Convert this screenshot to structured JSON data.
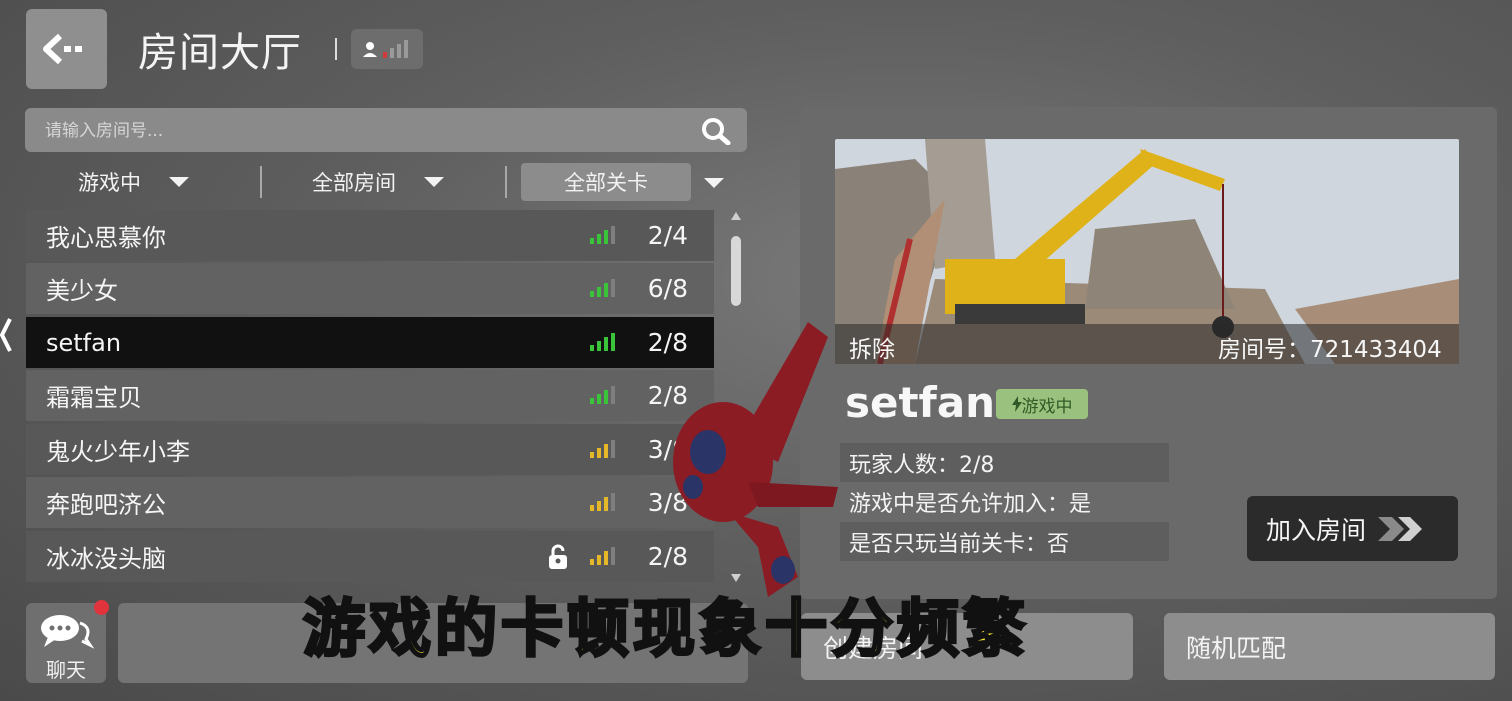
{
  "header": {
    "title": "房间大厅"
  },
  "search": {
    "placeholder": "请输入房间号..."
  },
  "filters": [
    {
      "label": "游戏中"
    },
    {
      "label": "全部房间"
    },
    {
      "label": "全部关卡"
    }
  ],
  "rooms": [
    {
      "name": "我心思慕你",
      "count": "2/4",
      "signal": "green",
      "locked": false
    },
    {
      "name": "美少女",
      "count": "6/8",
      "signal": "green",
      "locked": false
    },
    {
      "name": "setfan",
      "count": "2/8",
      "signal": "green",
      "locked": false,
      "selected": true
    },
    {
      "name": "霜霜宝贝",
      "count": "2/8",
      "signal": "green",
      "locked": false
    },
    {
      "name": "鬼火少年小李",
      "count": "3/8",
      "signal": "yellow",
      "locked": false
    },
    {
      "name": "奔跑吧济公",
      "count": "3/8",
      "signal": "yellow",
      "locked": false
    },
    {
      "name": "冰冰没头脑",
      "count": "2/8",
      "signal": "yellow",
      "locked": true
    }
  ],
  "chat": {
    "label": "聊天"
  },
  "detail": {
    "map_name": "拆除",
    "room_id": "房间号：721433404",
    "room_title": "setfan",
    "status": "游戏中",
    "players": "玩家人数：2/8",
    "allow_join": "游戏中是否允许加入：是",
    "current_level_only": "是否只玩当前关卡：否",
    "join_label": "加入房间"
  },
  "actions": {
    "create_label": "创建房间",
    "random_label": "随机匹配"
  },
  "caption": "游戏的卡顿现象十分频繁",
  "colors": {
    "signal_green": "#39c43a",
    "signal_yellow": "#e5b82a",
    "selected_row": "#111111",
    "status_badge": "#9ac27e",
    "caption_text": "#ffe93a"
  }
}
